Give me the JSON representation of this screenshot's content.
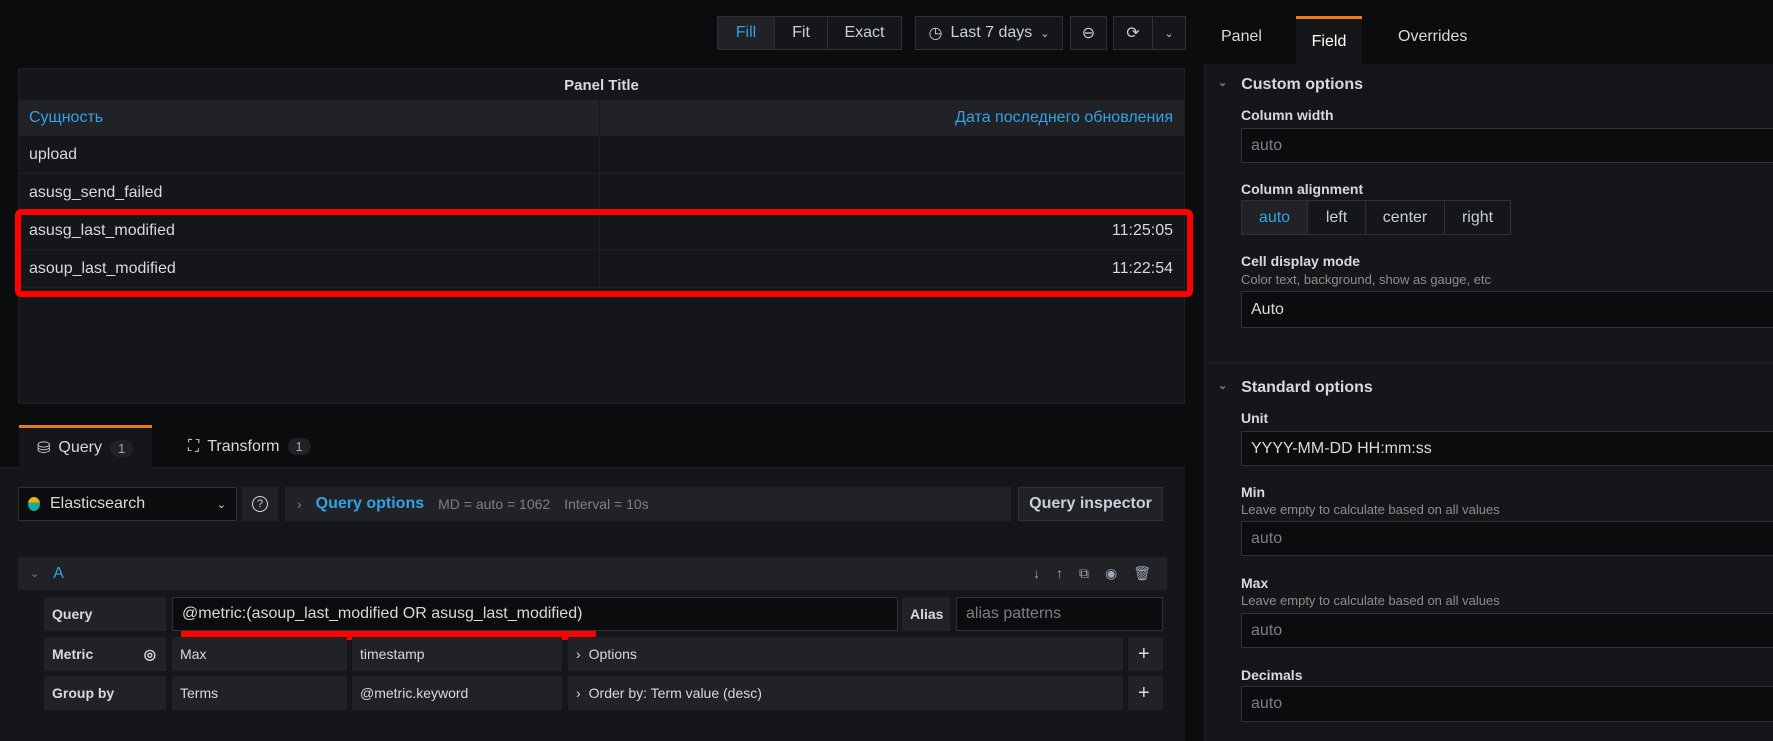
{
  "toolbar": {
    "fill": "Fill",
    "fit": "Fit",
    "exact": "Exact",
    "time_range": "Last 7 days"
  },
  "panel": {
    "title": "Panel Title",
    "columns": [
      "Сущность",
      "Дата последнего обновления"
    ],
    "rows": [
      {
        "name": "upload",
        "value": ""
      },
      {
        "name": "asusg_send_failed",
        "value": ""
      },
      {
        "name": "asusg_last_modified",
        "value": "11:25:05"
      },
      {
        "name": "asoup_last_modified",
        "value": "11:22:54"
      }
    ]
  },
  "query_tabs": {
    "query": "Query",
    "query_count": "1",
    "transform": "Transform",
    "transform_count": "1"
  },
  "datasource": {
    "name": "Elasticsearch",
    "help": "?",
    "query_options": "Query options",
    "md": "MD = auto = 1062",
    "interval": "Interval = 10s",
    "inspector": "Query inspector"
  },
  "query_a": {
    "ref": "A",
    "query_label": "Query",
    "query_value": "@metric:(asoup_last_modified OR asusg_last_modified)",
    "alias_label": "Alias",
    "alias_placeholder": "alias patterns",
    "metric_label": "Metric",
    "metric_type": "Max",
    "metric_field": "timestamp",
    "metric_options": "Options",
    "groupby_label": "Group by",
    "groupby_type": "Terms",
    "groupby_field": "@metric.keyword",
    "groupby_order": "Order by: Term value (desc)"
  },
  "side_tabs": {
    "panel": "Panel",
    "field": "Field",
    "overrides": "Overrides"
  },
  "custom": {
    "title": "Custom options",
    "col_width": "Column width",
    "col_width_ph": "auto",
    "col_align": "Column alignment",
    "align_opts": [
      "auto",
      "left",
      "center",
      "right"
    ],
    "cell_mode": "Cell display mode",
    "cell_mode_desc": "Color text, background, show as gauge, etc",
    "cell_mode_value": "Auto"
  },
  "standard": {
    "title": "Standard options",
    "unit": "Unit",
    "unit_value": "YYYY-MM-DD HH:mm:ss",
    "min": "Min",
    "min_desc": "Leave empty to calculate based on all values",
    "min_ph": "auto",
    "max": "Max",
    "max_desc": "Leave empty to calculate based on all values",
    "max_ph": "auto",
    "decimals": "Decimals",
    "decimals_ph": "auto"
  },
  "colors": {
    "accent": "#33a2e5",
    "highlight": "#ff0000"
  }
}
